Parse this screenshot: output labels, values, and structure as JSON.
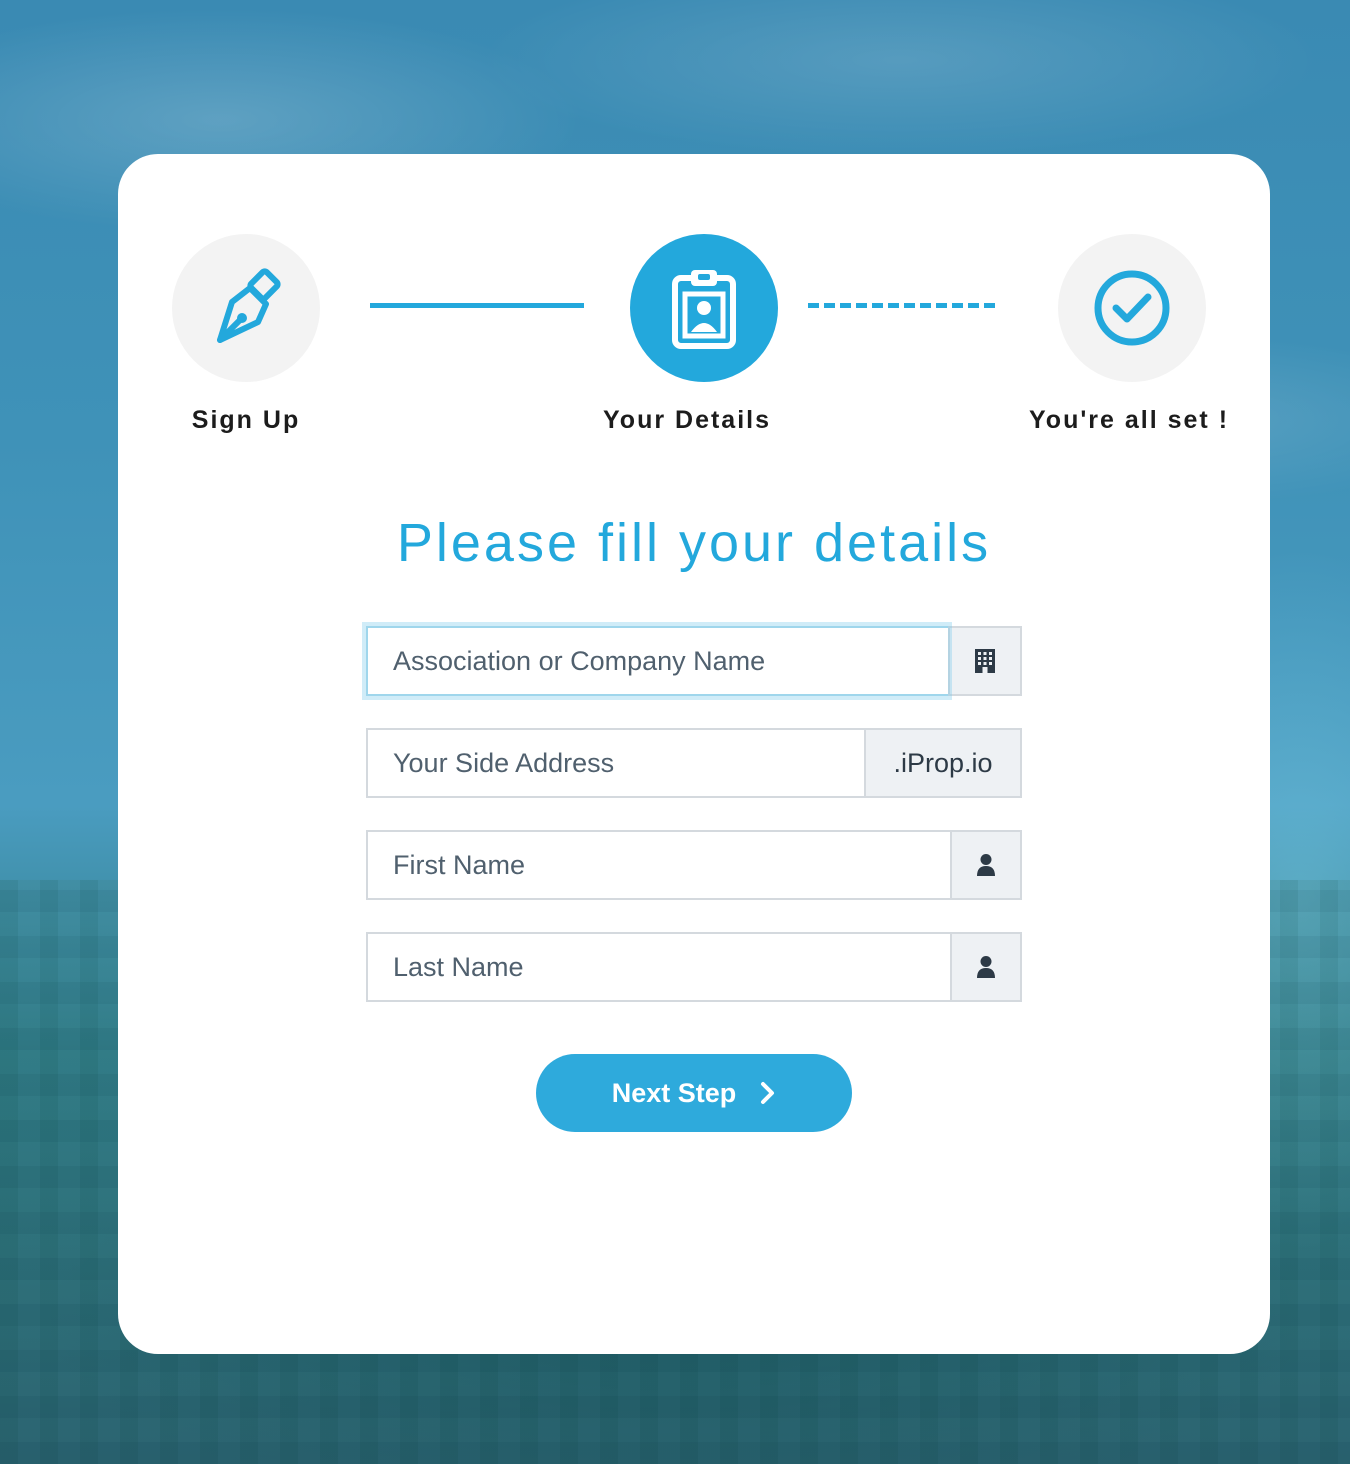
{
  "steps": [
    {
      "label": "Sign Up",
      "icon": "pen-nib-icon",
      "state": "done"
    },
    {
      "label": "Your Details",
      "icon": "id-badge-icon",
      "state": "active"
    },
    {
      "label": "You're all set !",
      "icon": "check-circle-icon",
      "state": "pending"
    }
  ],
  "form": {
    "heading": "Please fill your details",
    "company": {
      "placeholder": "Association or Company Name",
      "value": "",
      "icon": "building-icon"
    },
    "address": {
      "placeholder": "Your Side Address",
      "value": "",
      "suffix": ".iProp.io"
    },
    "first_name": {
      "placeholder": "First Name",
      "value": "",
      "icon": "user-icon"
    },
    "last_name": {
      "placeholder": "Last Name",
      "value": "",
      "icon": "user-icon"
    },
    "next_label": "Next Step"
  },
  "colors": {
    "accent": "#23a8dc",
    "button": "#2eaadc",
    "step_inactive": "#f3f3f3"
  }
}
